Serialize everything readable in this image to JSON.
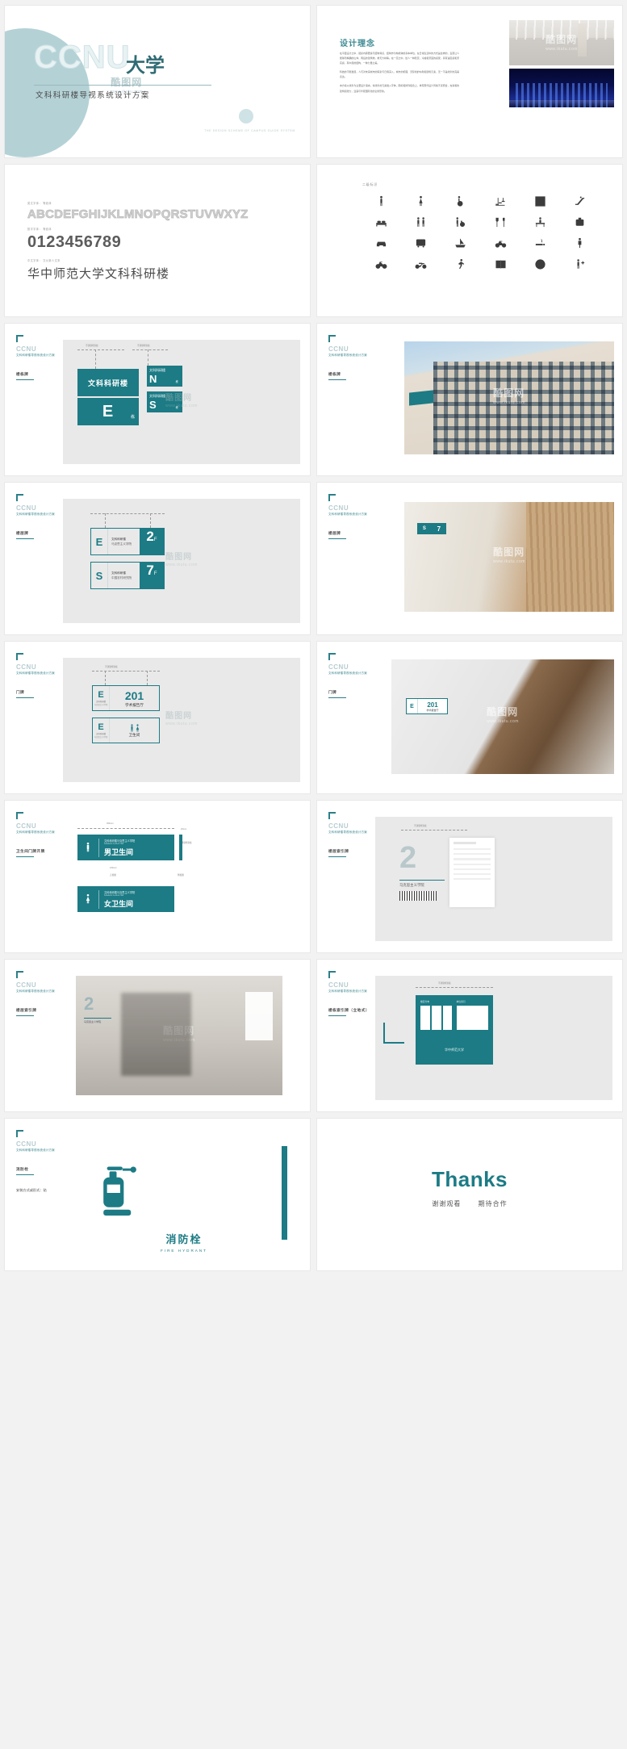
{
  "meta": {
    "brand_latin": "CCNU",
    "brand_cn": "大学",
    "project_title": "文科科研楼导视系统设计方案",
    "brand_sub_line1": "文科科研楼导视系统设计方案",
    "cover_en": "THE DESIGN SCHEME OF CAMPUS\nGUIDE SYSTEM",
    "accent": "#1c7b85",
    "accent_light": "#b4d2d6",
    "watermark": "酷图网",
    "watermark_url": "www.ikutu.com"
  },
  "slides": [
    {
      "id": "cover",
      "name": "cover-slide",
      "logo": "CCNU",
      "cn": "大学",
      "subtitle": "文科科研楼导视系统设计方案",
      "footer_en": "THE DESIGN SCHEME OF CAMPUS GUIDE SYSTEM"
    },
    {
      "id": "concept",
      "name": "design-concept-slide",
      "heading": "设计理念",
      "paragraphs": [
        "在平面设计之中，组织内容要素与结构特点、结构作为构成体的基本单位，在日常生活中的方式是这样的，直观让人能够到精确的山体，雨后的建筑物，参天大树等。在一定之中，给人一种稳定，冷峻和坚固的感受，具有速度感和坚实感，有中展的结构，一种力量之美。",
        "科技的不断发展，人们对未来城市的探索与日俱深入，城市的机理、天际线的勾勒和建筑元素，无一不是线条的完美表达。",
        "本方案以线条为主要设计语言，将线条的元素融入字体，图标和排列组合上，体现现代设计风格不谋而合，充满着的建筑和张力，显露与华夏国际化的全新形象。"
      ],
      "images": [
        {
          "name": "lobby-photo",
          "kind": "lobby"
        },
        {
          "name": "night-city-photo",
          "kind": "city"
        }
      ]
    },
    {
      "id": "typography",
      "name": "typography-slide",
      "rows": [
        {
          "label": "英文字体：  等线体",
          "sample": "ABCDEFGHIJKLMNOPQRSTUVWXYZ",
          "style": "latin"
        },
        {
          "label": "数字字体：  等线体",
          "sample": "0123456789",
          "style": "num"
        },
        {
          "label": "中文字体：  汉仪新人文宋",
          "sample": "华中师范大学文科科研楼",
          "style": "cn"
        }
      ]
    },
    {
      "id": "pictograms",
      "name": "pictogram-slide",
      "heading": "二级标识",
      "icons": [
        "male-restroom-icon",
        "female-restroom-icon",
        "accessible-icon",
        "stairs-icon",
        "elevator-icon",
        "escalator-icon",
        "bed-icon",
        "meeting-icon",
        "wheelchair-push-icon",
        "dining-icon",
        "reception-icon",
        "baggage-icon",
        "car-icon",
        "bus-icon",
        "boat-icon",
        "bicycle-parking-icon",
        "smoking-icon",
        "person-icon",
        "bicycle-icon",
        "motorcycle-icon",
        "runner-icon",
        "book-icon",
        "help-desk-icon",
        "first-aid-icon"
      ]
    },
    {
      "id": "building-sign",
      "name": "building-sign-design-slide",
      "section": "楼栋牌",
      "boards": [
        {
          "title": "文科科研楼",
          "letter": "E",
          "suffix": "栋"
        },
        {
          "title": "文科科研楼",
          "letter": "N",
          "suffix": "栋"
        },
        {
          "title": "文科科研楼",
          "letter": "S",
          "suffix": "栋"
        }
      ],
      "dim_top": "不锈钢烤漆板"
    },
    {
      "id": "building-sign-photo",
      "name": "building-sign-photo-slide",
      "section": "楼栋牌",
      "image": {
        "name": "building-exterior-photo",
        "kind": "bldg"
      }
    },
    {
      "id": "floor-sign",
      "name": "floor-sign-design-slide",
      "section": "楼层牌",
      "boards": [
        {
          "letter": "E",
          "num": "2",
          "unit": "F",
          "line1": "文科科研楼",
          "line2": "马克思主义学院"
        },
        {
          "letter": "S",
          "num": "7",
          "unit": "F",
          "line1": "文科科研楼",
          "line2": "中国农村研究院"
        }
      ]
    },
    {
      "id": "floor-sign-photo",
      "name": "floor-sign-photo-slide",
      "section": "楼层牌",
      "image": {
        "name": "corridor-photo",
        "kind": "corr"
      },
      "board": {
        "letter": "S",
        "num": "7"
      }
    },
    {
      "id": "door-sign",
      "name": "door-sign-design-slide",
      "section": "门牌",
      "boards": [
        {
          "letter": "E",
          "num": "201",
          "line1": "文科科研楼",
          "line2": "马克思主义学院",
          "right": "学术报告厅"
        },
        {
          "letter": "E",
          "num": "",
          "line1": "文科科研楼",
          "line2": "马克思主义学院",
          "right": "卫生间"
        }
      ],
      "dim_top": "不锈钢烤漆板"
    },
    {
      "id": "door-sign-photo",
      "name": "door-sign-photo-slide",
      "section": "门牌",
      "image": {
        "name": "interior-door-photo",
        "kind": "door"
      },
      "board": {
        "letter": "E",
        "num": "201",
        "right": "学术报告厅"
      }
    },
    {
      "id": "restroom-sign",
      "name": "restroom-sign-design-slide",
      "section": "卫生间门牌开牌",
      "boards": [
        {
          "sub": "文科科研楼马克思主义学院",
          "sub_en": "Academic Lecture Hall",
          "label": "男卫生间",
          "icon": "male-icon"
        },
        {
          "sub": "文科科研楼马克思主义学院",
          "sub_en": "Academic Lecture Hall",
          "label": "女卫生间",
          "icon": "female-icon"
        }
      ],
      "dims": [
        "350mm",
        "20mm",
        "150mm",
        "正视图",
        "侧视图",
        "不锈钢烤漆板"
      ]
    },
    {
      "id": "floor-index",
      "name": "floor-index-design-slide",
      "section": "楼层索引牌",
      "board": {
        "num": "2",
        "label": "马克思主义学院"
      },
      "dim_top": "不锈钢烤漆板"
    },
    {
      "id": "floor-index-photo",
      "name": "floor-index-photo-slide",
      "section": "楼层索引牌",
      "image": {
        "name": "elevator-lobby-photo",
        "kind": "elev"
      },
      "board": {
        "num": "2",
        "label": "马克思主义学院"
      }
    },
    {
      "id": "directory",
      "name": "directory-board-slide",
      "section": "楼栋索引牌（立地式）",
      "board": {
        "footer": "华中师范大学",
        "col_head_left": "楼层分布",
        "col_head_right": "单位索引"
      },
      "dim_top": "不锈钢烤漆板"
    },
    {
      "id": "fire-hydrant",
      "name": "fire-hydrant-sign-slide",
      "section": "消防栓",
      "section2": "安装方式或形式：贴",
      "board": {
        "cn": "消防栓",
        "en": "FIRE HYDRANT",
        "icon": "fire-extinguisher-icon"
      }
    },
    {
      "id": "thanks",
      "name": "thanks-slide",
      "en": "Thanks",
      "cn_left": "谢谢观看",
      "cn_right": "期待合作"
    }
  ]
}
